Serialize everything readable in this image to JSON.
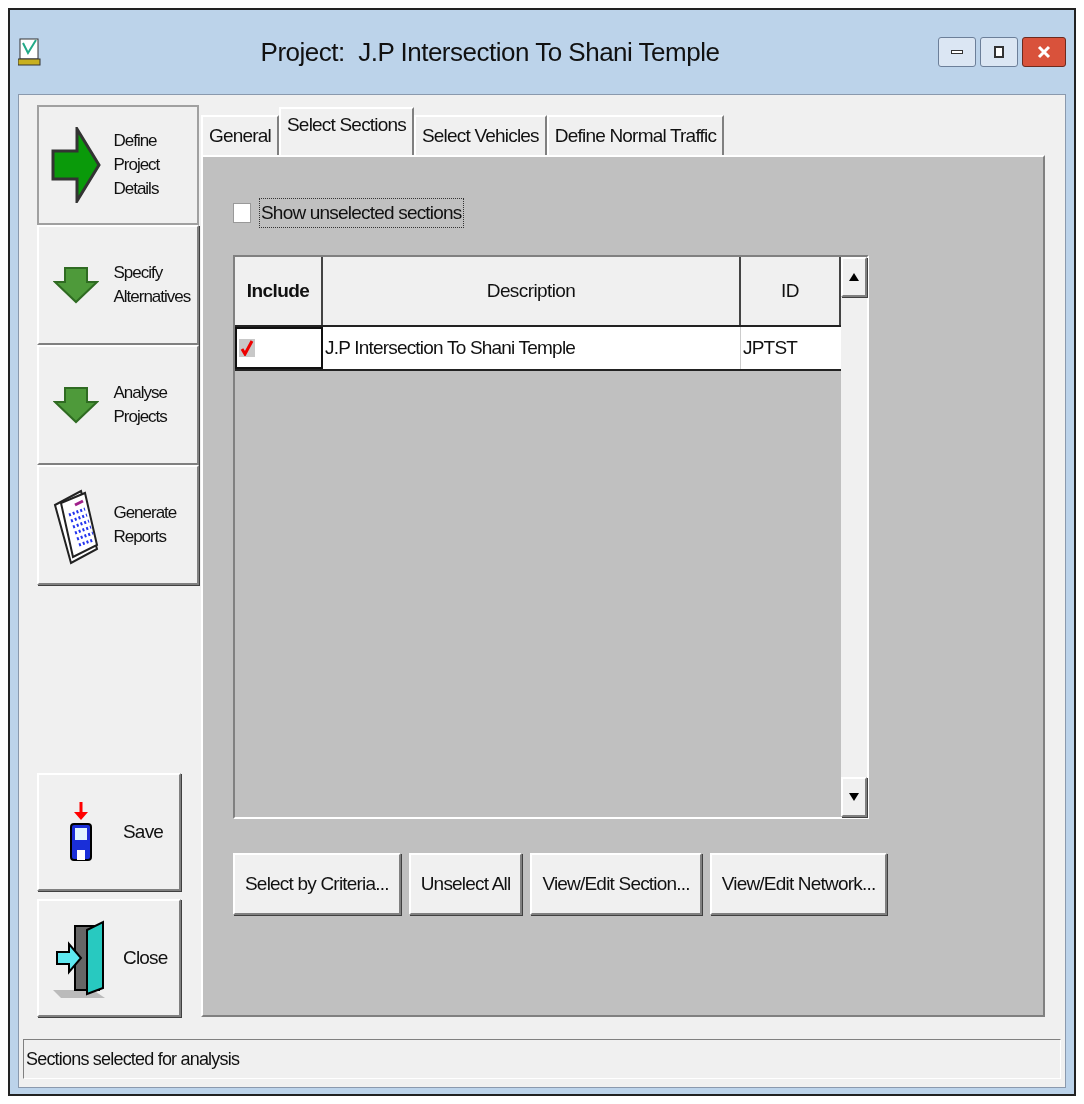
{
  "window": {
    "title": "Project:  J.P Intersection To Shani Temple"
  },
  "sidebar": {
    "items": [
      {
        "label": "Define Project Details",
        "kind": "right-arrow",
        "selected": true
      },
      {
        "label": "Specify Alternatives",
        "kind": "down-arrow",
        "selected": false
      },
      {
        "label": "Analyse Projects",
        "kind": "down-arrow",
        "selected": false
      },
      {
        "label": "Generate Reports",
        "kind": "reports",
        "selected": false
      }
    ],
    "actions": [
      {
        "label": "Save",
        "kind": "save"
      },
      {
        "label": "Close",
        "kind": "exit"
      }
    ]
  },
  "tabs": [
    {
      "label": "General",
      "selected": false
    },
    {
      "label": "Select Sections",
      "selected": true
    },
    {
      "label": "Select Vehicles",
      "selected": false
    },
    {
      "label": "Define Normal Traffic",
      "selected": false
    }
  ],
  "show_unselected": {
    "label": "Show unselected sections",
    "checked": false
  },
  "table": {
    "columns": [
      "Include",
      "Description",
      "ID"
    ],
    "rows": [
      {
        "include": true,
        "description": "J.P Intersection To Shani Temple",
        "id": "JPTST"
      }
    ]
  },
  "buttons": [
    "Select by Criteria...",
    "Unselect All",
    "View/Edit Section...",
    "View/Edit Network..."
  ],
  "status_bar": "Sections selected for analysis"
}
